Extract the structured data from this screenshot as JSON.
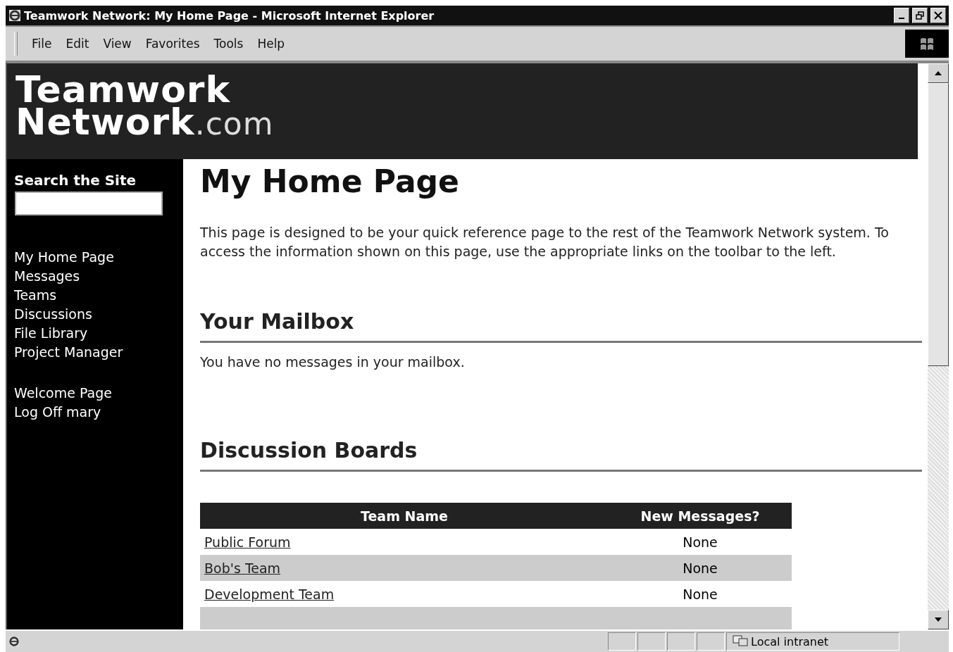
{
  "window": {
    "title": "Teamwork Network: My Home Page - Microsoft Internet Explorer"
  },
  "menu": [
    "File",
    "Edit",
    "View",
    "Favorites",
    "Tools",
    "Help"
  ],
  "logo": {
    "line1": "Teamwork",
    "line2": "Network",
    "suffix": ".com"
  },
  "sidebar": {
    "search_label": "Search the Site",
    "links": [
      "My Home Page",
      "Messages",
      "Teams",
      "Discussions",
      "File Library",
      "Project Manager"
    ],
    "links_secondary": [
      "Welcome Page",
      "Log Off mary"
    ]
  },
  "main": {
    "title": "My Home Page",
    "intro": "This page is designed to be your quick reference page to the rest of the Teamwork Network system. To access the information shown on this page, use the appropriate links on the toolbar to the left.",
    "mailbox": {
      "heading": "Your Mailbox",
      "text": "You have no messages in your mailbox."
    },
    "discussions": {
      "heading": "Discussion Boards",
      "columns": [
        "Team Name",
        "New Messages?"
      ],
      "rows": [
        {
          "team": "Public Forum",
          "new": "None"
        },
        {
          "team": "Bob's Team",
          "new": "None"
        },
        {
          "team": "Development Team",
          "new": "None"
        }
      ]
    }
  },
  "status_bar": {
    "zone": "Local intranet"
  }
}
